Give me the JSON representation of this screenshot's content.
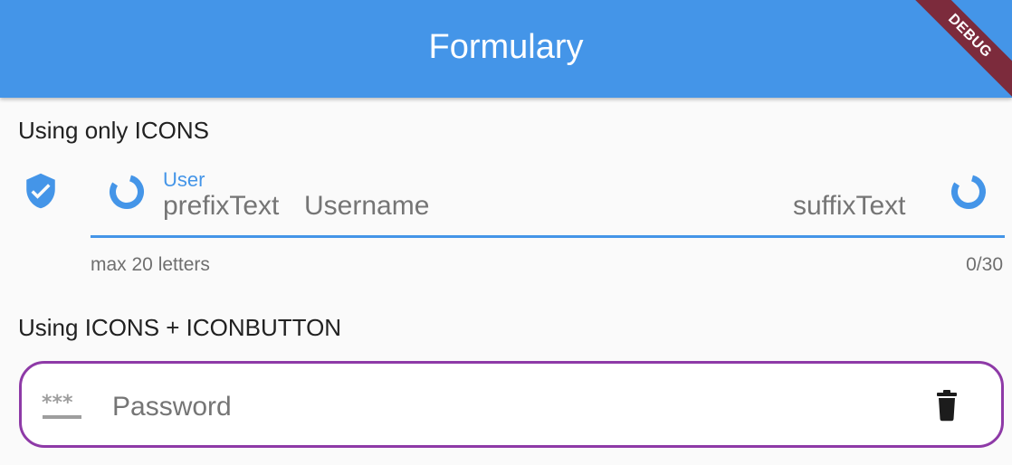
{
  "appbar": {
    "title": "Formulary",
    "color": "#4495e8",
    "debug_banner": "DEBUG"
  },
  "section_icons": {
    "label": "Using only ICONS",
    "field": {
      "icon": "verified-user-icon",
      "prefix_icon": "donut-icon",
      "suffix_icon": "donut-icon",
      "label": "User",
      "prefix_text": "prefixText",
      "hint": "Username",
      "suffix_text": "suffixText",
      "helper": "max 20 letters",
      "counter": "0/30",
      "accent": "#4495e8"
    }
  },
  "section_iconbutton": {
    "label": "Using ICONS + ICONBUTTON",
    "field": {
      "prefix_icon": "password-icon",
      "placeholder": "Password",
      "suffix_button_icon": "delete-icon",
      "border_color": "#8e3aa7"
    }
  }
}
